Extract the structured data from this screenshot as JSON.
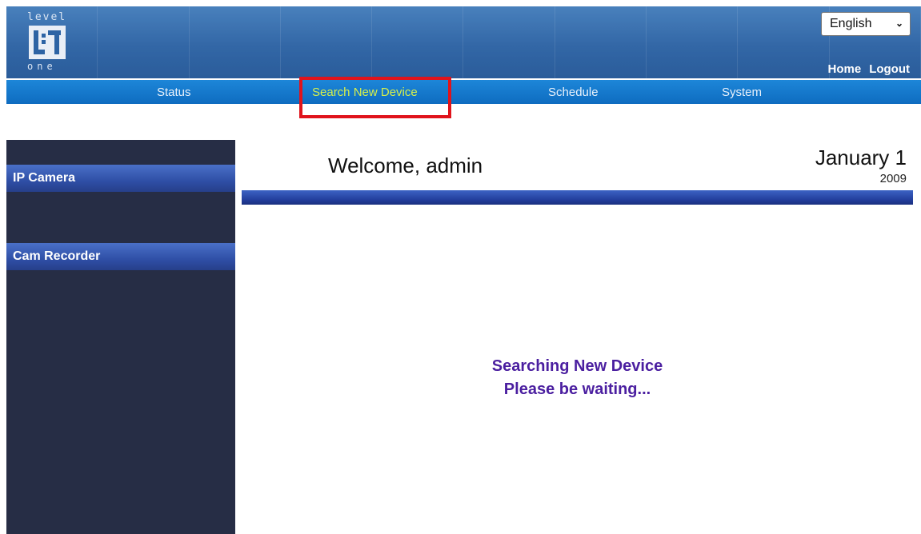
{
  "header": {
    "logo_top": "level",
    "logo_bottom": "one",
    "language": "English",
    "links": {
      "home": "Home",
      "logout": "Logout"
    }
  },
  "nav": {
    "status": "Status",
    "search_new_device": "Search New Device",
    "schedule": "Schedule",
    "system": "System",
    "active": "search_new_device",
    "active_color": "#d7f04a",
    "highlight_color": "#e0141c"
  },
  "sidebar": {
    "items": [
      {
        "label": "IP Camera"
      },
      {
        "label": "Cam Recorder"
      }
    ]
  },
  "main": {
    "welcome": "Welcome, admin",
    "date": "January 1",
    "year": "2009",
    "message_line1": "Searching New Device",
    "message_line2": "Please be waiting..."
  }
}
